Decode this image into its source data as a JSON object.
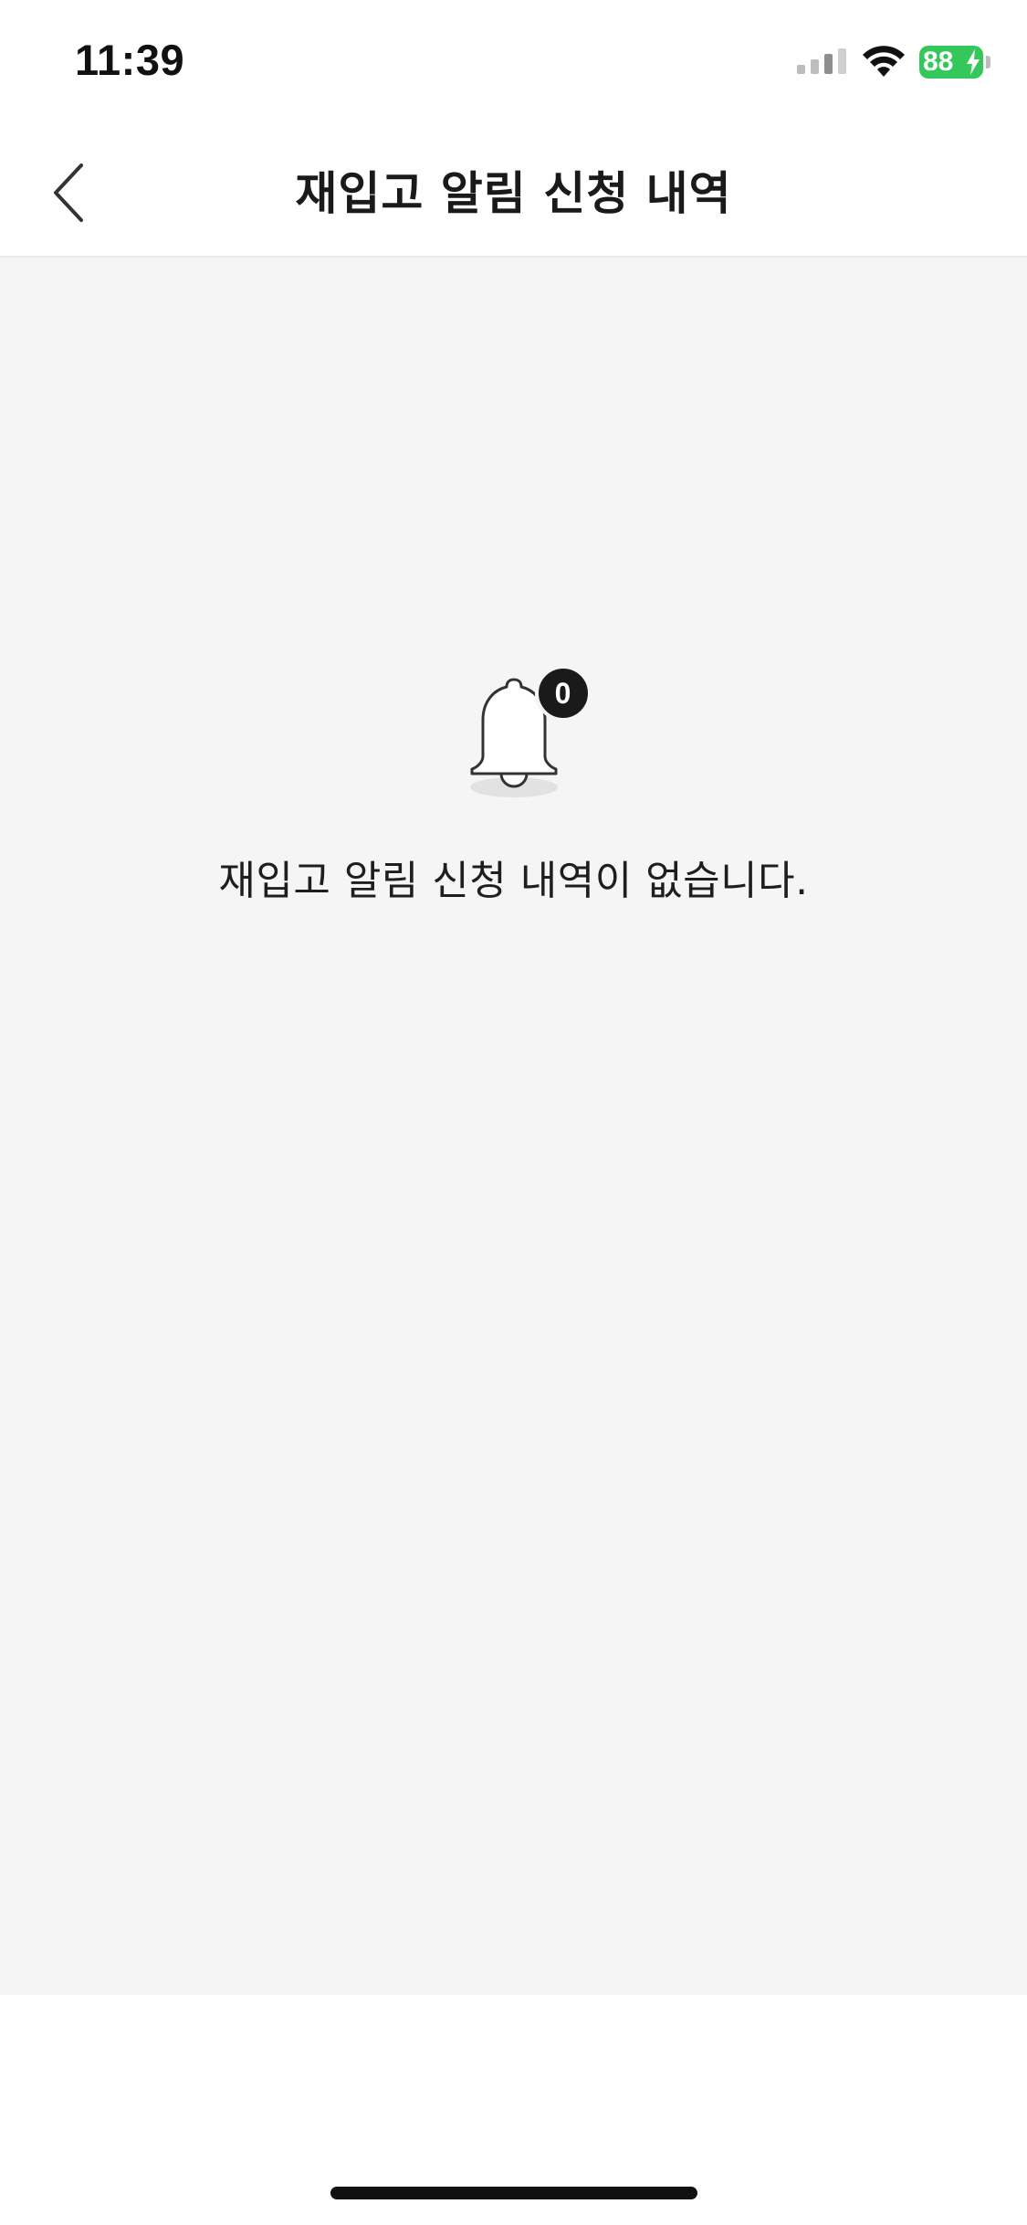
{
  "status_bar": {
    "time": "11:39",
    "battery_level": "88",
    "battery_color": "#34c759",
    "icons": [
      "cellular-signal-icon",
      "wifi-icon",
      "battery-icon",
      "charging-bolt-icon"
    ]
  },
  "nav": {
    "title": "재입고 알림 신청 내역",
    "back_icon": "chevron-left-icon"
  },
  "empty_state": {
    "icon": "bell-icon",
    "badge_count": "0",
    "message": "재입고 알림 신청 내역이 없습니다."
  },
  "colors": {
    "content_background": "#f5f5f5",
    "badge_background": "#1a1a1a",
    "text_primary": "#1a1a1a"
  }
}
